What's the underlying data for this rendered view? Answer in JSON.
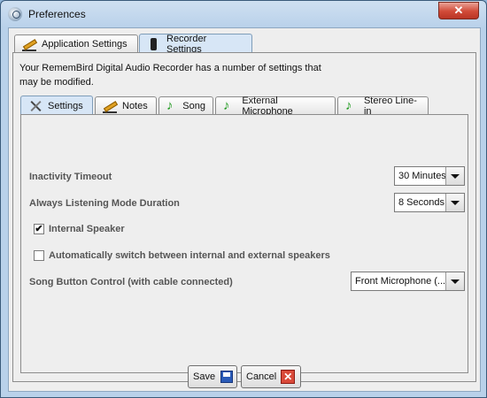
{
  "window": {
    "title": "Preferences",
    "close_glyph": "✕"
  },
  "outer_tabs": [
    {
      "label": "Application Settings",
      "icon": "pencil-icon"
    },
    {
      "label": "Recorder Settings",
      "icon": "recorder-icon"
    }
  ],
  "intro_text": "Your RememBird Digital Audio Recorder has a number of settings that may be modified.",
  "inner_tabs": [
    {
      "label": "Settings",
      "icon": "tools-icon"
    },
    {
      "label": "Notes",
      "icon": "pencil-icon"
    },
    {
      "label": "Song",
      "icon": "music-note-icon"
    },
    {
      "label": "External Microphone",
      "icon": "music-note-icon"
    },
    {
      "label": "Stereo Line-in",
      "icon": "music-note-icon"
    }
  ],
  "settings": {
    "inactivity_label": "Inactivity Timeout",
    "inactivity_value": "30 Minutes",
    "listening_label": "Always Listening Mode Duration",
    "listening_value": "8 Seconds",
    "internal_speaker_label": "Internal Speaker",
    "internal_speaker_checked": true,
    "auto_switch_label": "Automatically switch between internal and external speakers",
    "auto_switch_checked": false,
    "song_button_label": "Song Button Control (with cable connected)",
    "song_button_value": "Front Microphone (..."
  },
  "buttons": {
    "save_label": "Save",
    "cancel_label": "Cancel",
    "cancel_glyph": "✕"
  },
  "glyphs": {
    "check": "✔",
    "note": "♪"
  },
  "colors": {
    "active_tab": "#d7e6f6",
    "close_button": "#d14a37",
    "save_icon": "#2a5bb8",
    "cancel_icon": "#d94a3a",
    "note_icon": "#1e9a1e"
  }
}
